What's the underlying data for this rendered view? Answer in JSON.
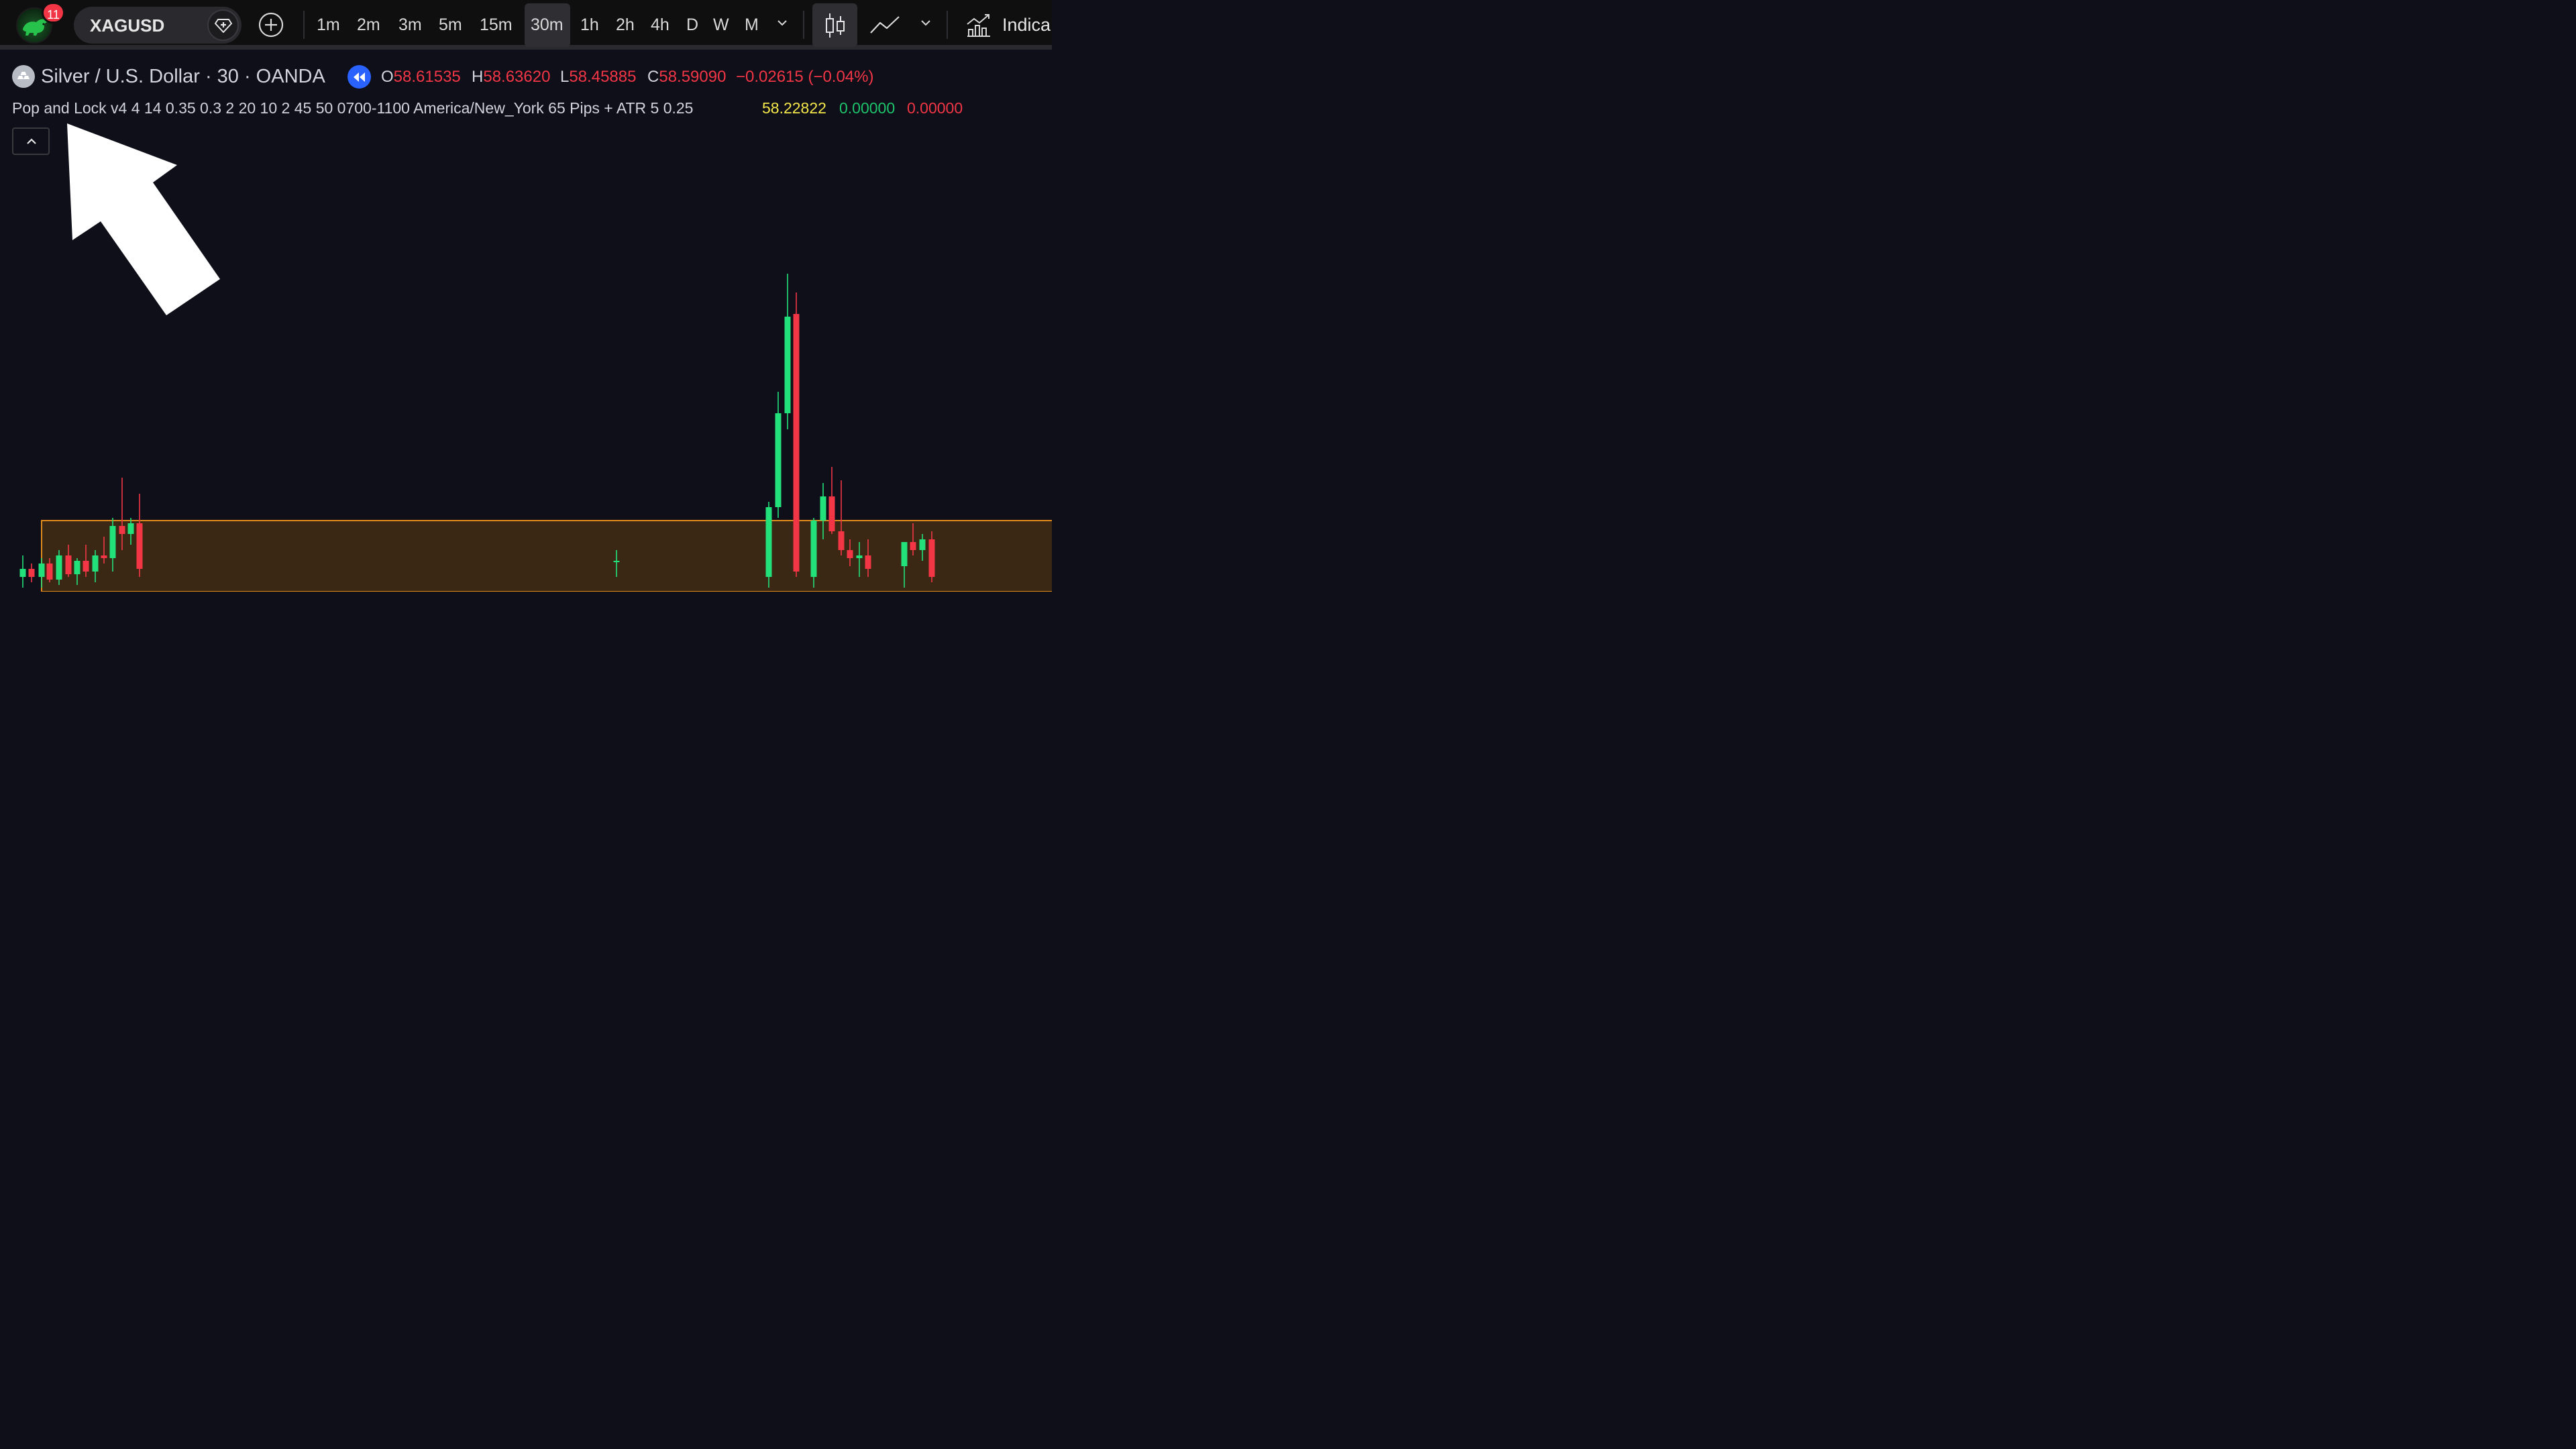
{
  "toolbar": {
    "notification_count": "11",
    "symbol": "XAGUSD",
    "intervals": [
      "1m",
      "2m",
      "3m",
      "5m",
      "15m",
      "30m",
      "1h",
      "2h",
      "4h",
      "D",
      "W",
      "M"
    ],
    "active_interval": "30m",
    "indicators_label": "Indica",
    "icons": [
      "add-icon",
      "chevron-down-icon",
      "candles-icon",
      "line-chart-icon",
      "indicators-icon"
    ]
  },
  "legend": {
    "title": "Silver / U.S. Dollar · 30 · OANDA",
    "open_key": "O",
    "open": "58.61535",
    "high_key": "H",
    "high": "58.63620",
    "low_key": "L",
    "low": "58.45885",
    "close_key": "C",
    "close": "58.59090",
    "change": "−0.02615 (−0.04%)",
    "colors": {
      "down": "#f23645",
      "up": "#22ab94",
      "text": "#d1d4dc"
    }
  },
  "indicator": {
    "name": "Pop and Lock v4 4 14 0.35 0.3 2 20 10 2 45 50 0700-1100 America/New_York 65 Pips + ATR 5 0.25",
    "value1": "58.22822",
    "value2": "0.00000",
    "value3": "0.00000",
    "colors": {
      "value1": "#f5e84a",
      "value2": "#1ec46b",
      "value3": "#f23645"
    }
  },
  "chart_data": {
    "type": "candlestick",
    "price_unit": "USD",
    "candles": [
      {
        "o": 58.3,
        "h": 58.38,
        "l": 58.26,
        "c": 58.33
      },
      {
        "o": 58.33,
        "h": 58.35,
        "l": 58.28,
        "c": 58.3
      },
      {
        "o": 58.3,
        "h": 58.37,
        "l": 58.26,
        "c": 58.35
      },
      {
        "o": 58.35,
        "h": 58.37,
        "l": 58.28,
        "c": 58.29
      },
      {
        "o": 58.29,
        "h": 58.4,
        "l": 58.27,
        "c": 58.38
      },
      {
        "o": 58.38,
        "h": 58.42,
        "l": 58.3,
        "c": 58.31
      },
      {
        "o": 58.31,
        "h": 58.37,
        "l": 58.27,
        "c": 58.36
      },
      {
        "o": 58.36,
        "h": 58.42,
        "l": 58.3,
        "c": 58.32
      },
      {
        "o": 58.32,
        "h": 58.4,
        "l": 58.28,
        "c": 58.38
      },
      {
        "o": 58.38,
        "h": 58.45,
        "l": 58.35,
        "c": 58.37
      },
      {
        "o": 58.37,
        "h": 58.52,
        "l": 58.32,
        "c": 58.49
      },
      {
        "o": 58.49,
        "h": 58.67,
        "l": 58.4,
        "c": 58.46
      },
      {
        "o": 58.46,
        "h": 58.52,
        "l": 58.42,
        "c": 58.5
      },
      {
        "o": 58.5,
        "h": 58.61,
        "l": 58.3,
        "c": 58.33
      },
      {
        "o": 58.36,
        "h": 58.4,
        "l": 58.3,
        "c": 58.36
      },
      {
        "o": 58.3,
        "h": 58.58,
        "l": 58.26,
        "c": 58.56
      },
      {
        "o": 58.56,
        "h": 58.99,
        "l": 58.52,
        "c": 58.91
      },
      {
        "o": 58.91,
        "h": 59.43,
        "l": 58.85,
        "c": 59.27
      },
      {
        "o": 59.28,
        "h": 59.36,
        "l": 58.3,
        "c": 58.32
      },
      {
        "o": 58.3,
        "h": 58.52,
        "l": 58.26,
        "c": 58.51
      },
      {
        "o": 58.51,
        "h": 58.65,
        "l": 58.44,
        "c": 58.6
      },
      {
        "o": 58.6,
        "h": 58.71,
        "l": 58.46,
        "c": 58.47
      },
      {
        "o": 58.47,
        "h": 58.66,
        "l": 58.38,
        "c": 58.4
      },
      {
        "o": 58.4,
        "h": 58.44,
        "l": 58.34,
        "c": 58.37
      },
      {
        "o": 58.37,
        "h": 58.43,
        "l": 58.3,
        "c": 58.38
      },
      {
        "o": 58.38,
        "h": 58.44,
        "l": 58.3,
        "c": 58.33
      },
      {
        "o": 58.34,
        "h": 58.43,
        "l": 58.26,
        "c": 58.43
      },
      {
        "o": 58.43,
        "h": 58.5,
        "l": 58.38,
        "c": 58.4
      },
      {
        "o": 58.4,
        "h": 58.46,
        "l": 58.36,
        "c": 58.44
      },
      {
        "o": 58.44,
        "h": 58.47,
        "l": 58.28,
        "c": 58.3
      }
    ],
    "zone": {
      "low": 58.22822,
      "high": 58.51
    }
  }
}
